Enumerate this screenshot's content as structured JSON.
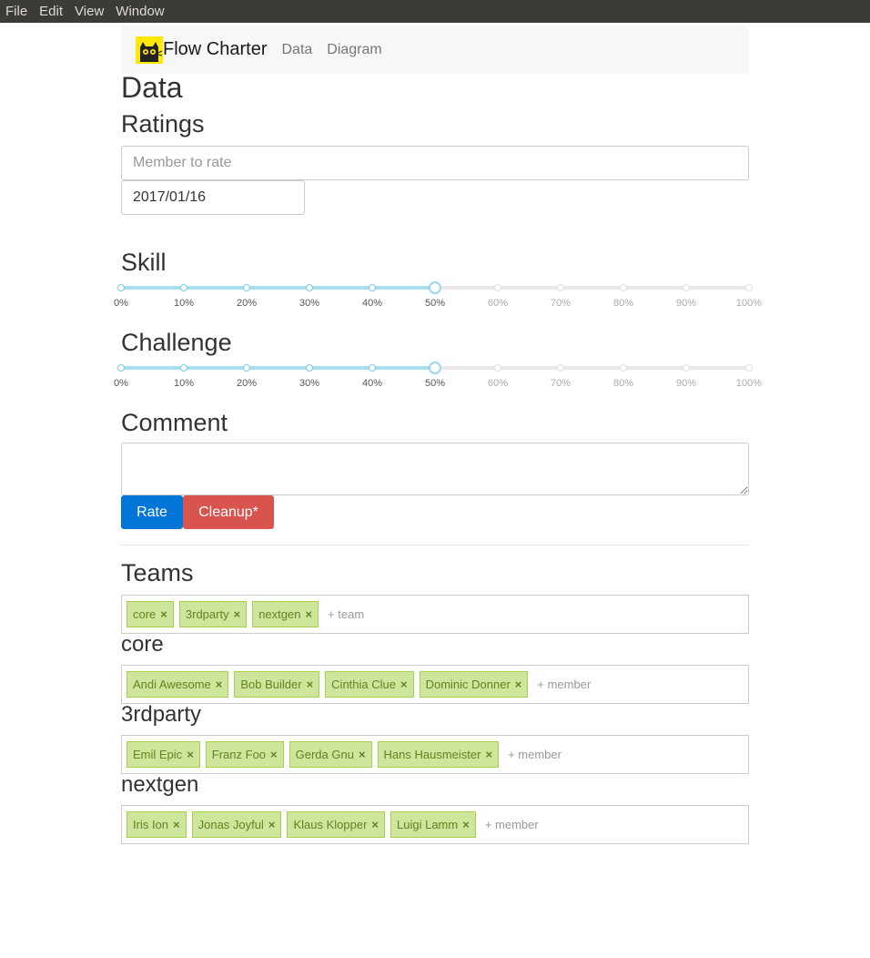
{
  "menubar": {
    "items": [
      "File",
      "Edit",
      "View",
      "Window"
    ]
  },
  "navbar": {
    "brand": "Flow Charter",
    "links": [
      "Data",
      "Diagram"
    ]
  },
  "page_title": "Data",
  "ratings": {
    "title": "Ratings",
    "member_placeholder": "Member to rate",
    "date_value": "2017/01/16"
  },
  "skill": {
    "title": "Skill",
    "value_percent": 50
  },
  "challenge": {
    "title": "Challenge",
    "value_percent": 50
  },
  "slider_labels": [
    "0%",
    "10%",
    "20%",
    "30%",
    "40%",
    "50%",
    "60%",
    "70%",
    "80%",
    "90%",
    "100%"
  ],
  "comment": {
    "title": "Comment",
    "value": ""
  },
  "buttons": {
    "rate": "Rate",
    "cleanup": "Cleanup*"
  },
  "teams": {
    "title": "Teams",
    "list": [
      "core",
      "3rdparty",
      "nextgen"
    ],
    "add_placeholder": "+ team",
    "remove_glyph": "×",
    "member_placeholder": "+ member",
    "groups": [
      {
        "name": "core",
        "members": [
          "Andi Awesome",
          "Bob Builder",
          "Cinthia Clue",
          "Dominic Donner"
        ]
      },
      {
        "name": "3rdparty",
        "members": [
          "Emil Epic",
          "Franz Foo",
          "Gerda Gnu",
          "Hans Hausmeister"
        ]
      },
      {
        "name": "nextgen",
        "members": [
          "Iris Ion",
          "Jonas Joyful",
          "Klaus Klopper",
          "Luigi Lamm"
        ]
      }
    ]
  },
  "colors": {
    "primary": "#0275d8",
    "danger": "#d9534f",
    "tag_bg": "#cde69c",
    "tag_text": "#638421",
    "slider_fill": "#a8def0"
  }
}
